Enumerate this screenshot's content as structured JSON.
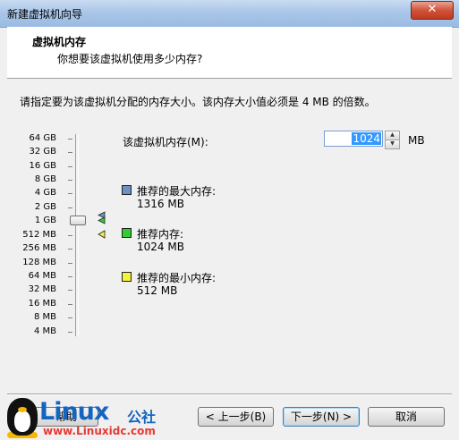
{
  "window": {
    "title": "新建虚拟机向导",
    "close_label": "✕"
  },
  "header": {
    "title": "虚拟机内存",
    "subtitle": "你想要该虚拟机使用多少内存?"
  },
  "instruction": "请指定要为该虚拟机分配的内存大小。该内存大小值必须是 4 MB 的倍数。",
  "scale": {
    "labels": [
      "64 GB",
      "32 GB",
      "16 GB",
      "8 GB",
      "4 GB",
      "2 GB",
      "1 GB",
      "512 MB",
      "256 MB",
      "128 MB",
      "64 MB",
      "32 MB",
      "16 MB",
      "8 MB",
      "4 MB"
    ]
  },
  "memory": {
    "label": "该虚拟机内存(M):",
    "value": "1024",
    "unit": "MB"
  },
  "legend": {
    "max": {
      "title": "推荐的最大内存:",
      "value": "1316 MB",
      "color": "#6f8fc7"
    },
    "recommended": {
      "title": "推荐内存:",
      "value": "1024 MB",
      "color": "#33cc33"
    },
    "min": {
      "title": "推荐的最小内存:",
      "value": "512 MB",
      "color": "#f2f240"
    }
  },
  "buttons": {
    "help": "帮助",
    "back": "< 上一步(B)",
    "next": "下一步(N) >",
    "cancel": "取消"
  },
  "watermark": {
    "brand": "Linux",
    "brand_cn": "公社",
    "url": "www.Linuxidc.com"
  }
}
